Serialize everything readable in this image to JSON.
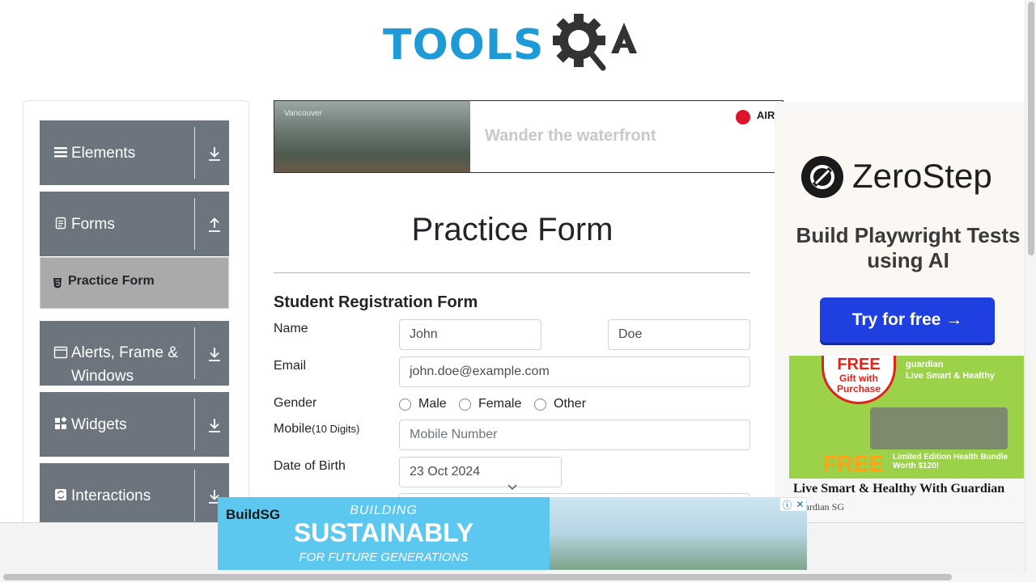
{
  "header": {
    "logo_text": "TOOLS",
    "logo_suffix": "QA"
  },
  "sidebar": {
    "groups": [
      {
        "label": "Elements",
        "icon": "menu-icon",
        "state": "collapsed"
      },
      {
        "label": "Forms",
        "icon": "form-icon",
        "state": "expanded"
      },
      {
        "label": "Alerts, Frame &\nWindows",
        "icon": "window-icon",
        "state": "collapsed"
      },
      {
        "label": "Widgets",
        "icon": "widgets-icon",
        "state": "collapsed"
      },
      {
        "label": "Interactions",
        "icon": "interactions-icon",
        "state": "collapsed"
      }
    ],
    "active_item": "Practice Form"
  },
  "ads": {
    "top_banner": {
      "photo_tag": "Vancouver",
      "tagline": "Wander the waterfront",
      "brand": "AIR"
    },
    "right_zerostep": {
      "name": "ZeroStep",
      "headline": "Build Playwright Tests using AI",
      "cta": "Try for free →"
    },
    "right_guardian": {
      "badge_free": "FREE",
      "badge_gift": "Gift with Purchase",
      "brand": "guardian",
      "brand_tagline": "Live Smart & Healthy",
      "free_big": "FREE",
      "promo_text": "Limited Edition Health Bundle Worth $120!",
      "caption": "Live Smart & Healthy With Guardian",
      "source": "Guardian SG"
    },
    "bottom_banner": {
      "logo": "BuildSG",
      "line1": "BUILDING",
      "line2": "SUSTAINABLY",
      "line3": "FOR FUTURE GENERATIONS",
      "info_symbol": "ⓘ",
      "close_symbol": "✕"
    }
  },
  "main": {
    "page_title": "Practice Form",
    "form_heading": "Student Registration Form",
    "name": {
      "label": "Name",
      "first_value": "John",
      "last_value": "Doe"
    },
    "email": {
      "label": "Email",
      "value": "john.doe@example.com"
    },
    "gender": {
      "label": "Gender",
      "options": [
        "Male",
        "Female",
        "Other"
      ]
    },
    "mobile": {
      "label": "Mobile",
      "label_hint": "(10 Digits)",
      "placeholder": "Mobile Number"
    },
    "dob": {
      "label": "Date of Birth",
      "value": "23 Oct 2024"
    }
  },
  "colors": {
    "sidebar_group": "#6c757d",
    "active_item": "#aaaaaa",
    "logo_blue": "#1e9ad6",
    "zerostep_button": "#1f3fe0"
  }
}
